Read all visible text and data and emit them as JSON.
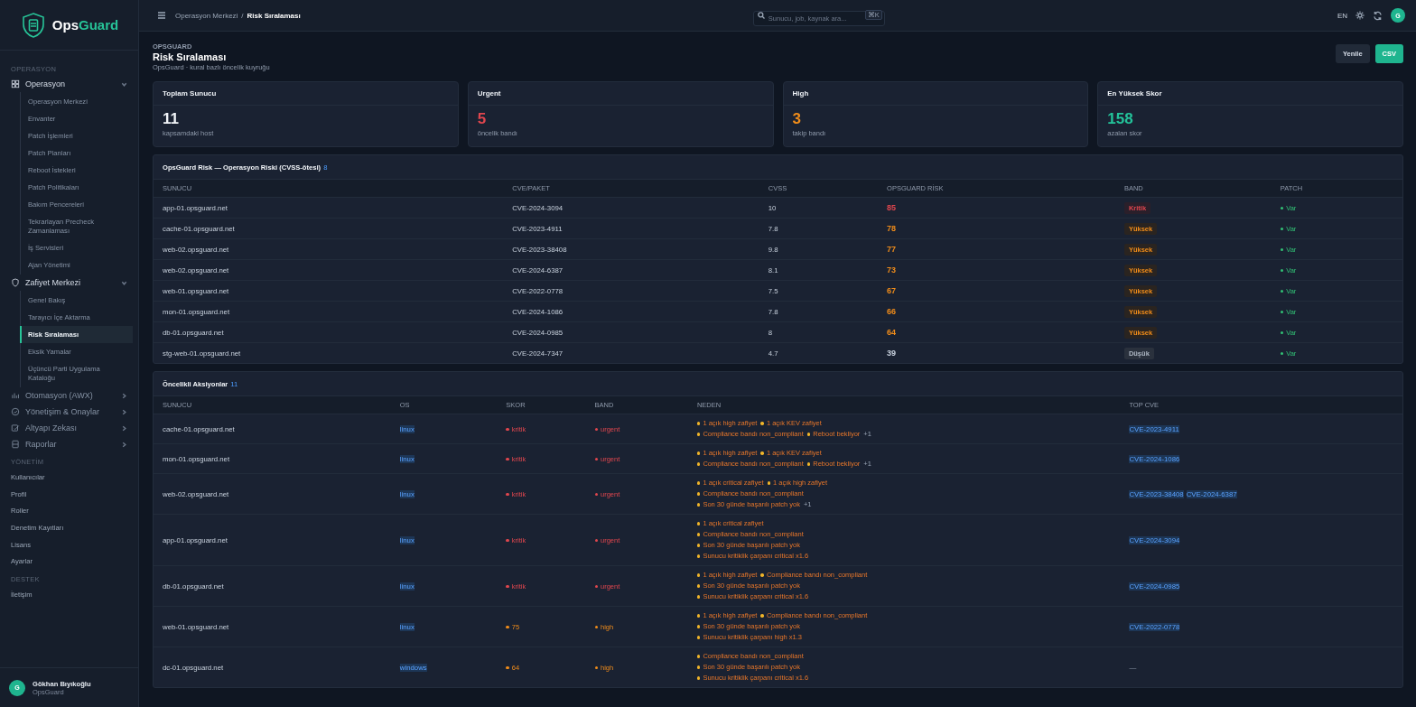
{
  "sidebar": {
    "logo": {
      "prefix": "Ops",
      "suffix": "Guard"
    },
    "sections": [
      {
        "heading": "OPERASYON",
        "groups": [
          {
            "label": "Operasyon",
            "expanded": true,
            "children": [
              {
                "label": "Operasyon Merkezi",
                "selected": false
              },
              {
                "label": "Envanter",
                "selected": false
              },
              {
                "label": "Patch İşlemleri",
                "selected": false
              },
              {
                "label": "Patch Planları",
                "selected": false
              },
              {
                "label": "Reboot İstekleri",
                "selected": false
              },
              {
                "label": "Patch Politikaları",
                "selected": false
              },
              {
                "label": "Bakım Pencereleri",
                "selected": false
              },
              {
                "label": "Tekrarlayan Precheck Zamanlaması",
                "selected": false
              },
              {
                "label": "İş Servisleri",
                "selected": false
              },
              {
                "label": "Ajan Yönetimi",
                "selected": false
              }
            ]
          },
          {
            "label": "Zafiyet Merkezi",
            "expanded": true,
            "children": [
              {
                "label": "Genel Bakış",
                "selected": false
              },
              {
                "label": "Tarayıcı İçe Aktarma",
                "selected": false
              },
              {
                "label": "Risk Sıralaması",
                "selected": true
              },
              {
                "label": "Eksik Yamalar",
                "selected": false
              },
              {
                "label": "Üçüncü Parti Uygulama Kataloğu",
                "selected": false
              }
            ]
          },
          {
            "label": "Otomasyon (AWX)",
            "expanded": false
          },
          {
            "label": "Yönetişim & Onaylar",
            "expanded": false
          },
          {
            "label": "Altyapı Zekası",
            "expanded": false
          },
          {
            "label": "Raporlar",
            "expanded": false
          }
        ]
      },
      {
        "heading": "YÖNETİM",
        "links": [
          "Kullanıcılar",
          "Profil",
          "Roller",
          "Denetim Kayıtları",
          "Lisans",
          "Ayarlar"
        ]
      },
      {
        "heading": "DESTEK",
        "links": [
          "İletişim"
        ]
      }
    ],
    "user": {
      "initial": "G",
      "name": "Gökhan Bıyıkoğlu",
      "org": "OpsGuard"
    }
  },
  "topbar": {
    "breadcrumb": [
      "Operasyon Merkezi",
      "Risk Sıralaması"
    ],
    "separator": "/",
    "search": {
      "placeholder": "Sunucu, job, kaynak ara...",
      "shortcut": "⌘K"
    },
    "language": "EN",
    "avatar": "G"
  },
  "header": {
    "eyebrow": "OPSGUARD",
    "title": "Risk Sıralaması",
    "subtitle": "OpsGuard · kural bazlı öncelik kuyruğu",
    "buttons": [
      {
        "label": "Yenile",
        "kind": "secondary"
      },
      {
        "label": "CSV",
        "kind": "primary"
      }
    ]
  },
  "stats": [
    {
      "title": "Toplam Sunucu",
      "value": "11",
      "note": "kapsamdaki host",
      "kind": "neutral"
    },
    {
      "title": "Urgent",
      "value": "5",
      "note": "öncelik bandı",
      "kind": "urgent"
    },
    {
      "title": "High",
      "value": "3",
      "note": "takip bandı",
      "kind": "high"
    },
    {
      "title": "En Yüksek Skor",
      "value": "158",
      "note": "azalan skor",
      "kind": "accent"
    }
  ],
  "risk_table": {
    "title": "OpsGuard Risk — Operasyon Riski (CVSS-ötesi)",
    "count": "8",
    "columns": [
      "SUNUCU",
      "CVE/PAKET",
      "CVSS",
      "OPSGUARD RİSK",
      "BAND",
      "PATCH"
    ],
    "rows": [
      {
        "host": "app-01.opsguard.net",
        "cve": "CVE-2024-3094",
        "cvss": "10",
        "risk": "85",
        "band": "Kritik",
        "kind": "critical",
        "patch": "Var"
      },
      {
        "host": "cache-01.opsguard.net",
        "cve": "CVE-2023-4911",
        "cvss": "7.8",
        "risk": "78",
        "band": "Yüksek",
        "kind": "high",
        "patch": "Var"
      },
      {
        "host": "web-02.opsguard.net",
        "cve": "CVE-2023-38408",
        "cvss": "9.8",
        "risk": "77",
        "band": "Yüksek",
        "kind": "high",
        "patch": "Var"
      },
      {
        "host": "web-02.opsguard.net",
        "cve": "CVE-2024-6387",
        "cvss": "8.1",
        "risk": "73",
        "band": "Yüksek",
        "kind": "high",
        "patch": "Var"
      },
      {
        "host": "web-01.opsguard.net",
        "cve": "CVE-2022-0778",
        "cvss": "7.5",
        "risk": "67",
        "band": "Yüksek",
        "kind": "high",
        "patch": "Var"
      },
      {
        "host": "mon-01.opsguard.net",
        "cve": "CVE-2024-1086",
        "cvss": "7.8",
        "risk": "66",
        "band": "Yüksek",
        "kind": "high",
        "patch": "Var"
      },
      {
        "host": "db-01.opsguard.net",
        "cve": "CVE-2024-0985",
        "cvss": "8",
        "risk": "64",
        "band": "Yüksek",
        "kind": "high",
        "patch": "Var"
      },
      {
        "host": "stg-web-01.opsguard.net",
        "cve": "CVE-2024-7347",
        "cvss": "4.7",
        "risk": "39",
        "band": "Düşük",
        "kind": "low",
        "patch": "Var"
      }
    ]
  },
  "actions_table": {
    "title": "Öncelikli Aksiyonlar",
    "count": "11",
    "columns": [
      "SUNUCU",
      "OS",
      "SKOR",
      "BAND",
      "NEDEN",
      "TOP CVE"
    ],
    "rows": [
      {
        "host": "cache-01.opsguard.net",
        "os": "linux",
        "score": "kritik",
        "band": "urgent",
        "kind": "urgent",
        "reasons": [
          [
            "1 açık high zafiyet",
            "1 açık KEV zafiyet"
          ],
          [
            "Compliance bandı non_compliant",
            "Reboot bekliyor",
            "+1"
          ]
        ],
        "top_cve": [
          "CVE-2023-4911"
        ]
      },
      {
        "host": "mon-01.opsguard.net",
        "os": "linux",
        "score": "kritik",
        "band": "urgent",
        "kind": "urgent",
        "reasons": [
          [
            "1 açık high zafiyet",
            "1 açık KEV zafiyet"
          ],
          [
            "Compliance bandı non_compliant",
            "Reboot bekliyor",
            "+1"
          ]
        ],
        "top_cve": [
          "CVE-2024-1086"
        ]
      },
      {
        "host": "web-02.opsguard.net",
        "os": "linux",
        "score": "kritik",
        "band": "urgent",
        "kind": "urgent",
        "reasons": [
          [
            "1 açık critical zafiyet",
            "1 açık high zafiyet"
          ],
          [
            "Compliance bandı non_compliant"
          ],
          [
            "Son 30 günde başarılı patch yok",
            "+1"
          ]
        ],
        "top_cve": [
          "CVE-2023-38408",
          "CVE-2024-6387"
        ]
      },
      {
        "host": "app-01.opsguard.net",
        "os": "linux",
        "score": "kritik",
        "band": "urgent",
        "kind": "urgent",
        "reasons": [
          [
            "1 açık critical zafiyet"
          ],
          [
            "Compliance bandı non_compliant"
          ],
          [
            "Son 30 günde başarılı patch yok"
          ],
          [
            "Sunucu kritiklik çarpanı critical x1.6"
          ]
        ],
        "top_cve": [
          "CVE-2024-3094"
        ]
      },
      {
        "host": "db-01.opsguard.net",
        "os": "linux",
        "score": "kritik",
        "band": "urgent",
        "kind": "urgent",
        "reasons": [
          [
            "1 açık high zafiyet",
            "Compliance bandı non_compliant"
          ],
          [
            "Son 30 günde başarılı patch yok"
          ],
          [
            "Sunucu kritiklik çarpanı critical x1.6"
          ]
        ],
        "top_cve": [
          "CVE-2024-0985"
        ]
      },
      {
        "host": "web-01.opsguard.net",
        "os": "linux",
        "score": "75",
        "band": "high",
        "kind": "high",
        "reasons": [
          [
            "1 açık high zafiyet",
            "Compliance bandı non_compliant"
          ],
          [
            "Son 30 günde başarılı patch yok"
          ],
          [
            "Sunucu kritiklik çarpanı high x1.3"
          ]
        ],
        "top_cve": [
          "CVE-2022-0778"
        ]
      },
      {
        "host": "dc-01.opsguard.net",
        "os": "windows",
        "score": "64",
        "band": "high",
        "kind": "high",
        "reasons": [
          [
            "Compliance bandı non_compliant"
          ],
          [
            "Son 30 günde başarılı patch yok"
          ],
          [
            "Sunucu kritiklik çarpanı critical x1.6"
          ]
        ],
        "no_cve": "—"
      }
    ]
  }
}
